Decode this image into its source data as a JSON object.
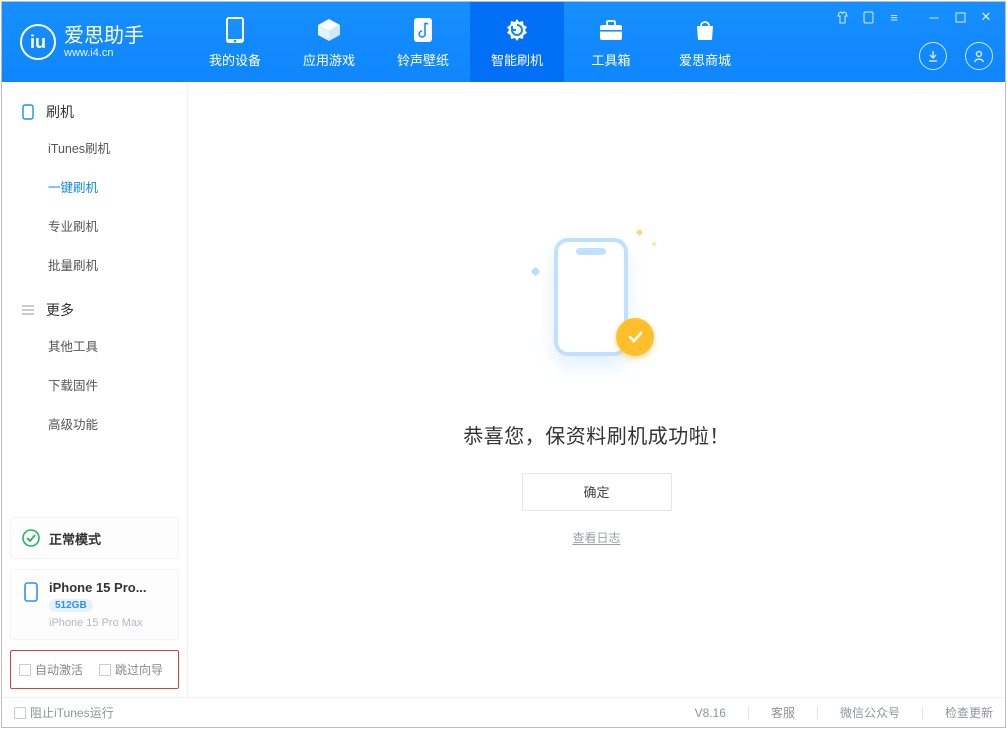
{
  "app": {
    "title": "爱思助手",
    "site": "www.i4.cn"
  },
  "nav": {
    "device": "我的设备",
    "apps": "应用游戏",
    "ringtones": "铃声壁纸",
    "flash": "智能刷机",
    "tools": "工具箱",
    "store": "爱思商城"
  },
  "sidebar": {
    "group_flash": "刷机",
    "items_flash": {
      "itunes": "iTunes刷机",
      "oneclick": "一键刷机",
      "pro": "专业刷机",
      "batch": "批量刷机"
    },
    "group_more": "更多",
    "items_more": {
      "other": "其他工具",
      "firmware": "下载固件",
      "advanced": "高级功能"
    },
    "mode_label": "正常模式",
    "device": {
      "name": "iPhone 15 Pro...",
      "capacity": "512GB",
      "full": "iPhone 15 Pro Max"
    },
    "cb_autoactivate": "自动激活",
    "cb_skipguide": "跳过向导"
  },
  "main": {
    "message": "恭喜您，保资料刷机成功啦！",
    "ok": "确定",
    "view_log": "查看日志"
  },
  "footer": {
    "block_itunes": "阻止iTunes运行",
    "version": "V8.16",
    "support": "客服",
    "wechat": "微信公众号",
    "update": "检查更新"
  }
}
